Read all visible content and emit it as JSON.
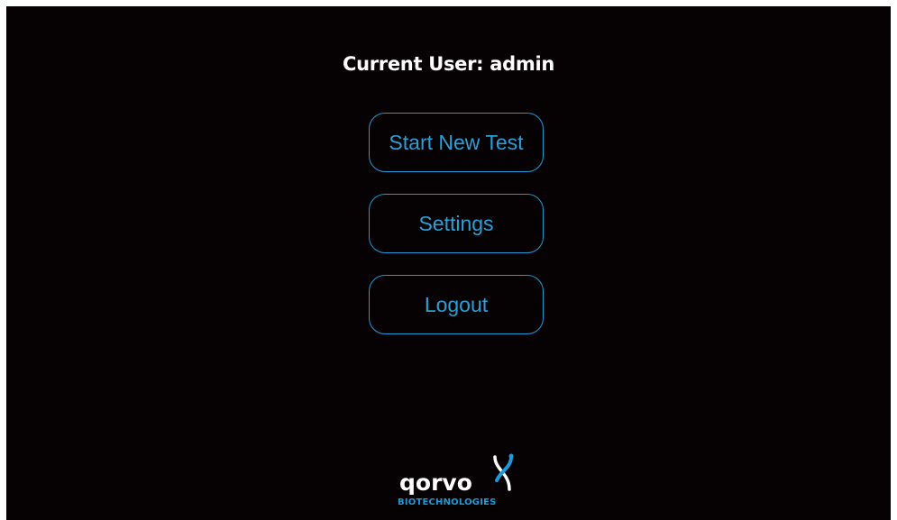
{
  "header": {
    "current_user_text": "Current User: admin"
  },
  "menu": {
    "start_new_test_label": "Start New Test",
    "settings_label": "Settings",
    "logout_label": "Logout"
  },
  "logo": {
    "wordmark": "qorvo",
    "subtitle": "BIOTECHNOLOGIES",
    "icon": "qorvo-dna-icon"
  },
  "colors": {
    "background": "#060102",
    "accent": "#1d9ad9",
    "text": "#ffffff"
  }
}
